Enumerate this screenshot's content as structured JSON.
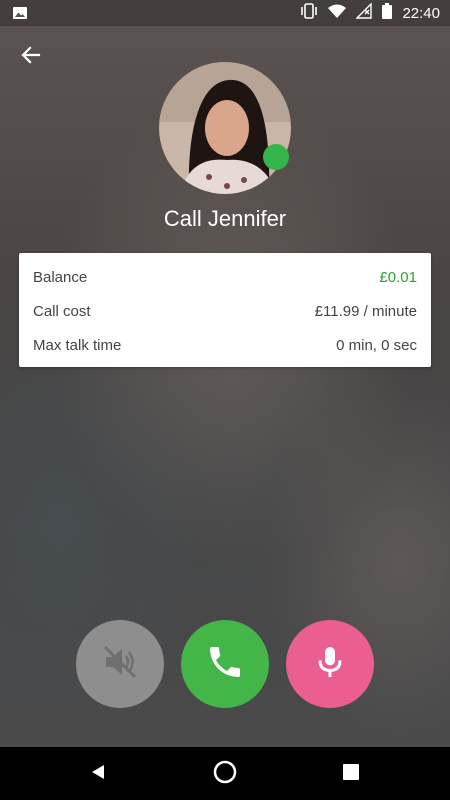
{
  "status_bar": {
    "time": "22:40",
    "icons": [
      "image-icon",
      "vibrate-icon",
      "wifi-icon",
      "no-signal-icon",
      "battery-icon"
    ]
  },
  "header": {
    "back_icon": "arrow-left-icon",
    "title": "Call Jennifer",
    "presence_color": "#34b54a"
  },
  "info_card": {
    "rows": [
      {
        "label": "Balance",
        "value": "£0.01",
        "value_color": "#2ca52f"
      },
      {
        "label": "Call cost",
        "value": "£11.99 / minute"
      },
      {
        "label": "Max talk time",
        "value": "0 min, 0 sec"
      }
    ]
  },
  "actions": [
    {
      "name": "speaker-off",
      "icon": "speaker-off-icon",
      "color": "#8e8e8e"
    },
    {
      "name": "call",
      "icon": "phone-icon",
      "color": "#43b549"
    },
    {
      "name": "microphone",
      "icon": "microphone-icon",
      "color": "#ea5e92"
    }
  ],
  "nav_bar": {
    "items": [
      "back-triangle-icon",
      "home-circle-icon",
      "recents-square-icon"
    ]
  }
}
